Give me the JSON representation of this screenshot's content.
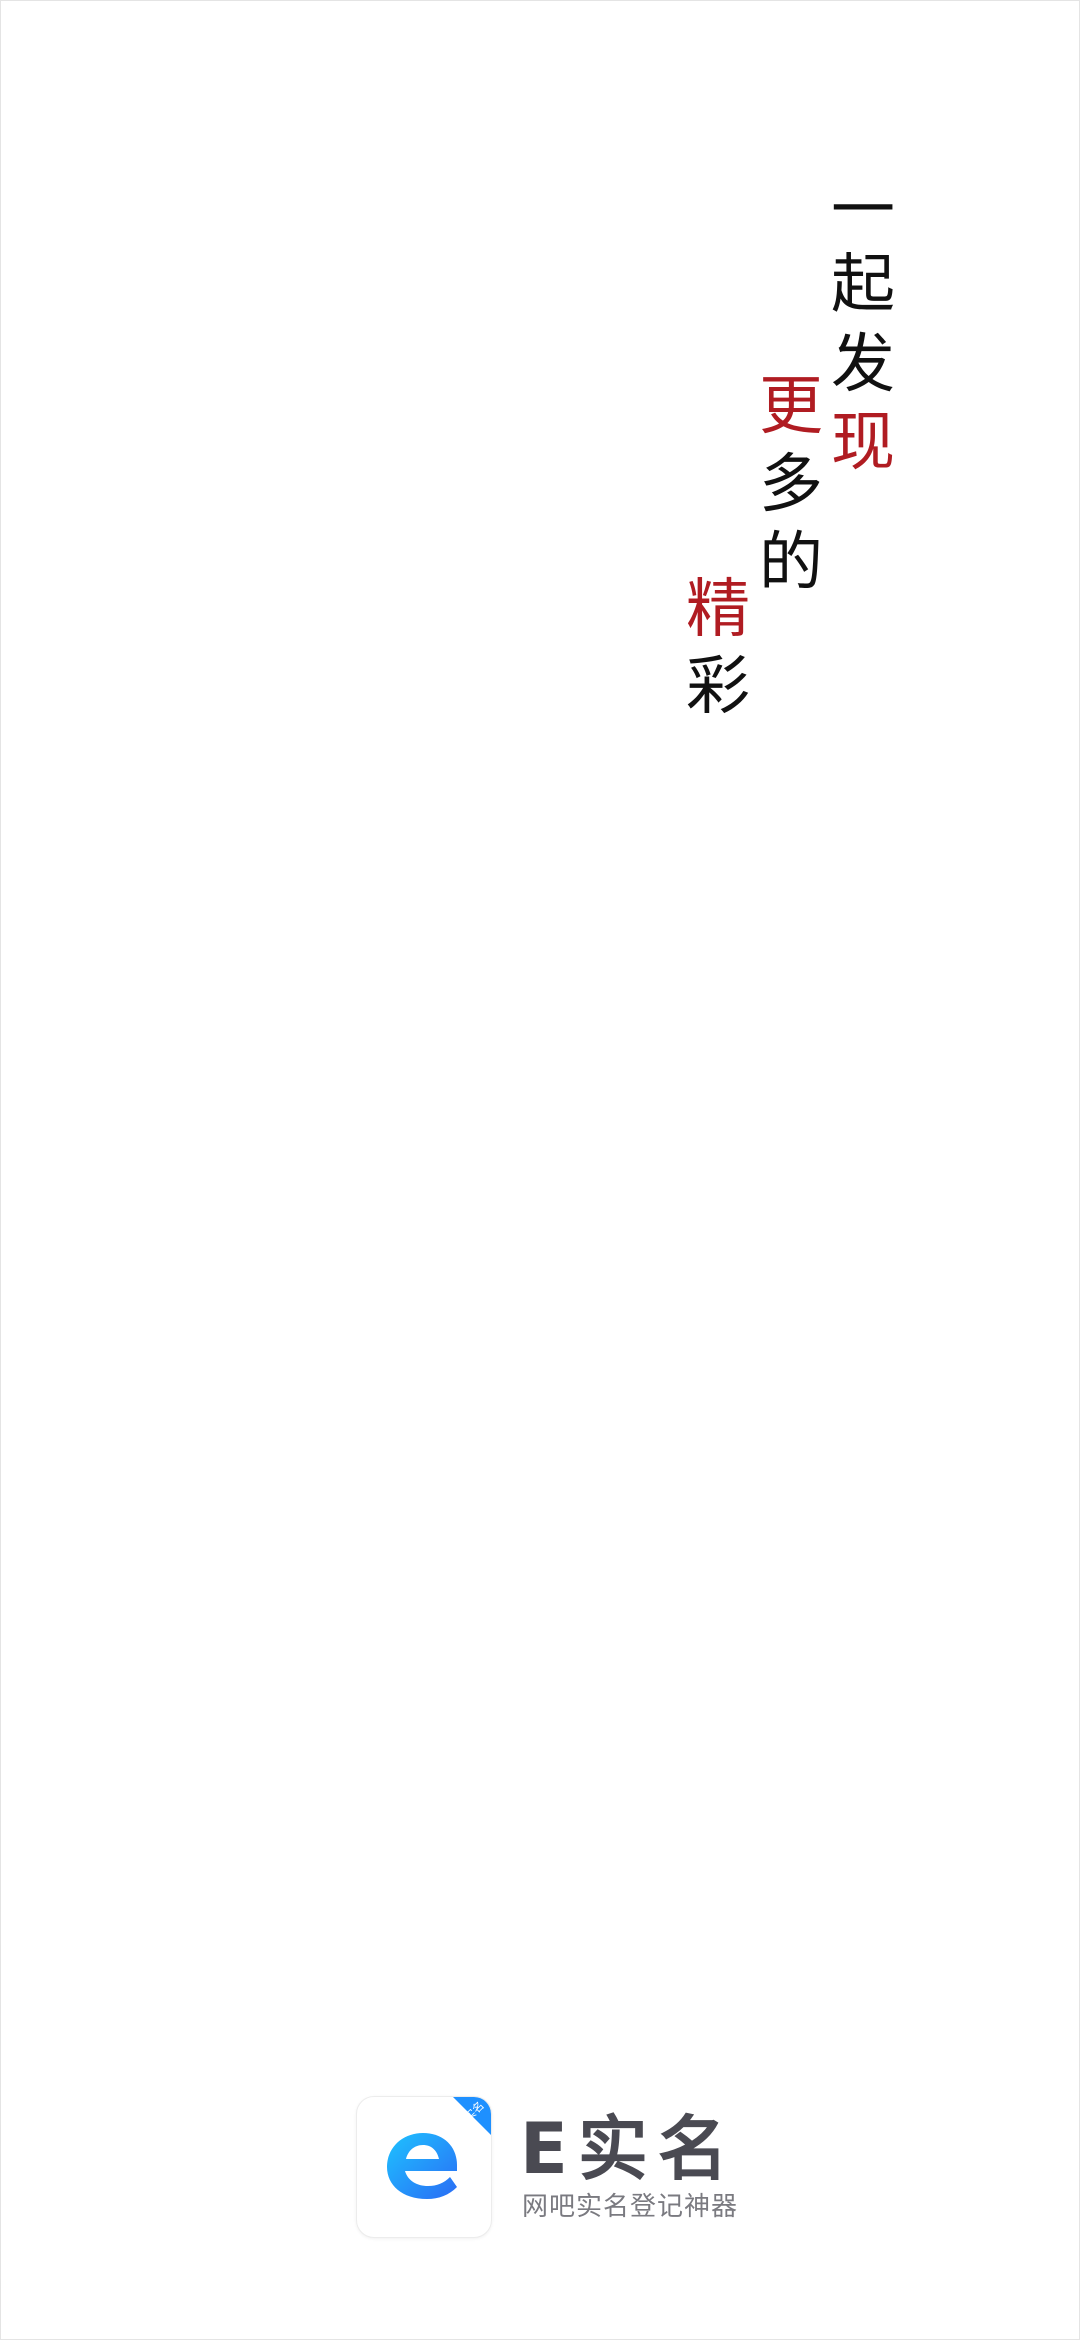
{
  "slogan": {
    "chars": [
      "一",
      "起",
      "发",
      "现",
      "更",
      "多",
      "的",
      "精",
      "彩"
    ],
    "accent_color": "#b01c22",
    "text_color": "#111111"
  },
  "brand": {
    "name": "E实名",
    "tagline": "网吧实名登记神器",
    "badge_text": "实名",
    "logo_icon": "e-logo-icon",
    "logo_gradient": [
      "#1ec3ff",
      "#2a6cf5"
    ]
  }
}
